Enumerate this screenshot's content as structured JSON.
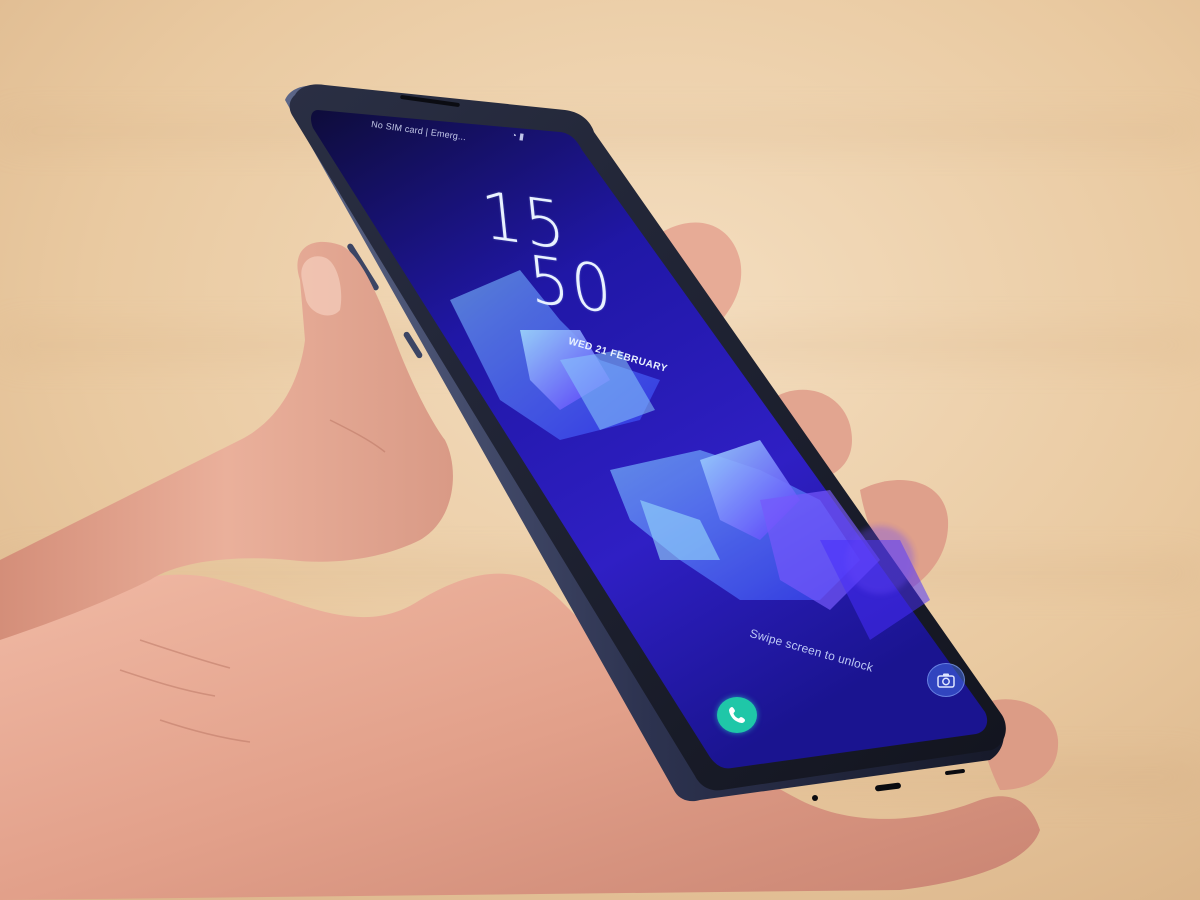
{
  "lockscreen": {
    "status_left": "No SIM card | Emerg...",
    "status_right": "◔ ▮",
    "clock": {
      "hour": "15",
      "minute": "50"
    },
    "date": "WED 21 FEBRUARY",
    "unlock_hint": "Swipe screen to unlock",
    "shortcuts": [
      {
        "name": "phone",
        "icon": "phone-icon"
      },
      {
        "name": "camera",
        "icon": "camera-icon"
      }
    ]
  },
  "colors": {
    "background_wood": "#e8c9a2",
    "phone_body": "#1a1d2b",
    "screen_wallpaper": "#2a1fb0",
    "accent_crystal": "#5fa6ff",
    "phone_shortcut": "#1fc7a8",
    "skin": "#e2a894"
  }
}
